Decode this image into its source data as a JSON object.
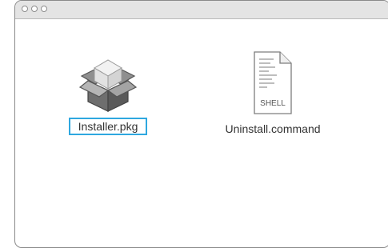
{
  "window": {
    "traffic_lights": [
      "close-button",
      "minimize-button",
      "zoom-button"
    ]
  },
  "files": [
    {
      "name": "Installer.pkg",
      "icon": "package-box-icon",
      "selected": true
    },
    {
      "name": "Uninstall.command",
      "icon": "shell-script-icon",
      "icon_badge": "SHELL",
      "selected": false
    }
  ],
  "colors": {
    "selection_border": "#2ea7e0",
    "titlebar": "#e4e4e4"
  }
}
